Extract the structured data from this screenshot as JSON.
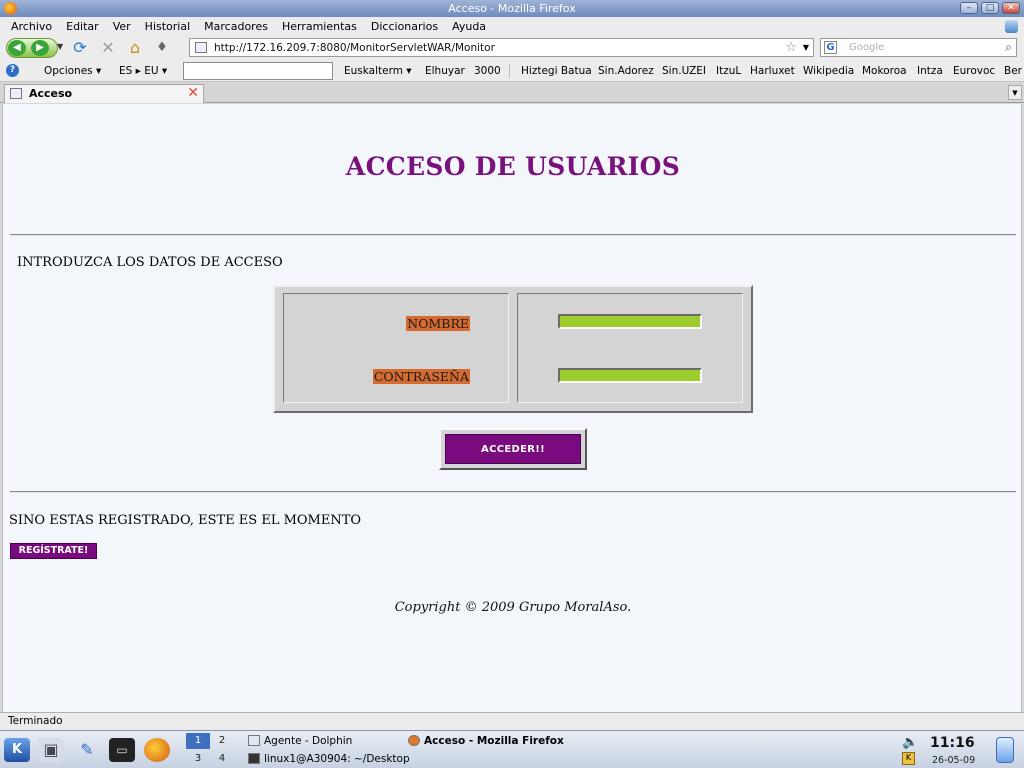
{
  "window": {
    "title": "Acceso - Mozilla Firefox"
  },
  "menu": [
    "Archivo",
    "Editar",
    "Ver",
    "Historial",
    "Marcadores",
    "Herramientas",
    "Diccionarios",
    "Ayuda"
  ],
  "nav": {
    "url": "http://172.16.209.7:8080/MonitorServletWAR/Monitor",
    "search_placeholder": "Google"
  },
  "bookmarks": {
    "opciones": "Opciones ▾",
    "lang": "ES ▸ EU ▾",
    "euskalterm": "Euskalterm ▾",
    "items": [
      "Elhuyar",
      "3000",
      "Hiztegi Batua",
      "Sin.Adorez",
      "Sin.UZEI",
      "ItzuL",
      "Harluxet",
      "Wikipedia",
      "Mokoroa",
      "Intza",
      "Eurovoc",
      "Ber"
    ]
  },
  "tab": {
    "label": "Acceso"
  },
  "page": {
    "title": "ACCESO DE USUARIOS",
    "intro": "INTRODUZCA LOS DATOS DE ACCESO",
    "name_label": "NOMBRE",
    "password_label": "CONTRASEÑA",
    "submit_label": "ACCEDER!!",
    "register_prompt": "SINO ESTAS REGISTRADO, ESTE ES EL MOMENTO",
    "register_button": "REGÍSTRATE!",
    "copyright": "Copyright © 2009 Grupo MoralAso."
  },
  "status": {
    "text": "Terminado"
  },
  "taskbar": {
    "desktops": [
      "1",
      "2",
      "3",
      "4"
    ],
    "tasks": [
      "Agente - Dolphin",
      "Acceso - Mozilla Firefox",
      "linux1@A30904: ~/Desktop"
    ],
    "time": "11:16",
    "date": "26-05-09"
  },
  "colors": {
    "title": "#7a127e",
    "label_bg": "#d66b2f",
    "input_bg": "#9ccd2d",
    "button_bg": "#7a0b7e",
    "page_bg": "#f3f7fb"
  }
}
